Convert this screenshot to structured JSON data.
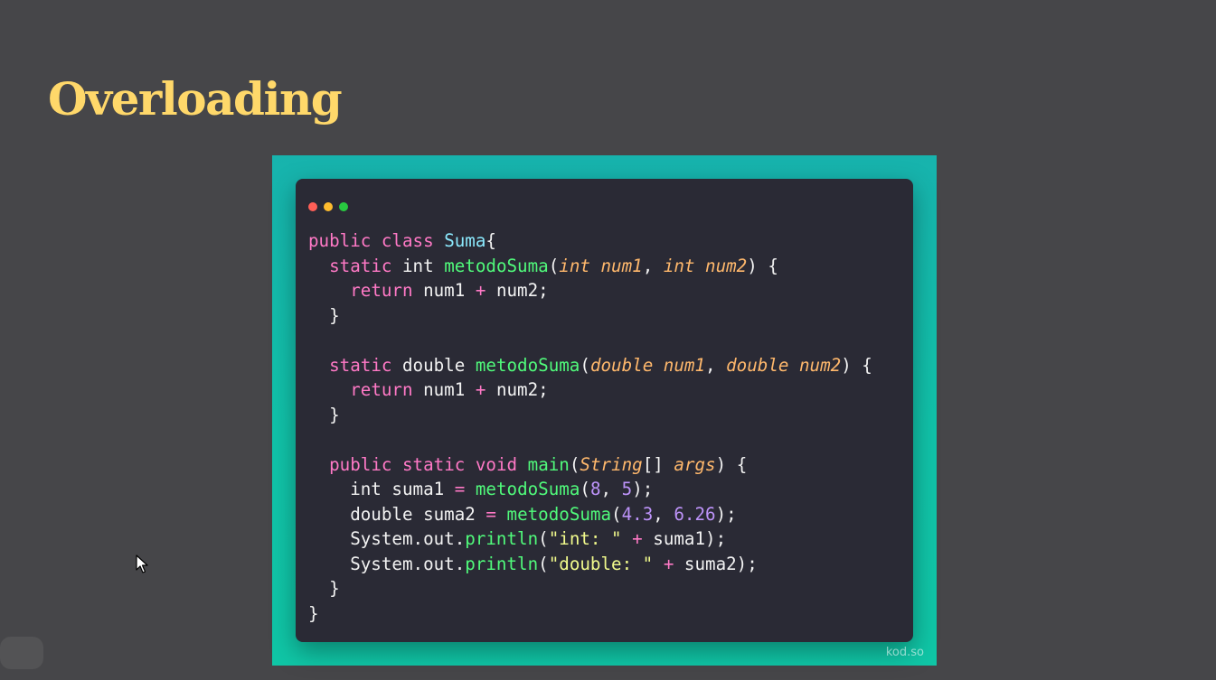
{
  "slide": {
    "title": "Overloading",
    "watermark": "kod.so"
  },
  "window_controls": [
    "close-dot",
    "minimize-dot",
    "maximize-dot"
  ],
  "colors": {
    "title": "#ffd86a",
    "background": "#464649",
    "frame_teal": "#11c3a9",
    "editor_bg": "#2a2a35",
    "keyword": "#ff79c6",
    "class_name": "#8be9fd",
    "function": "#50fa7b",
    "parameter": "#ffb86c",
    "number": "#bd93f9",
    "string": "#f1fa8c"
  },
  "code_lines": [
    [
      [
        "keyword",
        "public"
      ],
      [
        "plain",
        " "
      ],
      [
        "keyword",
        "class"
      ],
      [
        "plain",
        " "
      ],
      [
        "class",
        "Suma"
      ],
      [
        "plain",
        "{"
      ]
    ],
    [
      [
        "plain",
        "  "
      ],
      [
        "keyword",
        "static"
      ],
      [
        "plain",
        " int "
      ],
      [
        "func",
        "metodoSuma"
      ],
      [
        "plain",
        "("
      ],
      [
        "param",
        "int num1"
      ],
      [
        "plain",
        ", "
      ],
      [
        "param",
        "int num2"
      ],
      [
        "plain",
        ") {"
      ]
    ],
    [
      [
        "plain",
        "    "
      ],
      [
        "keyword",
        "return"
      ],
      [
        "plain",
        " num1 "
      ],
      [
        "keyword",
        "+"
      ],
      [
        "plain",
        " num2;"
      ]
    ],
    [
      [
        "plain",
        "  }"
      ]
    ],
    [
      [
        "plain",
        ""
      ]
    ],
    [
      [
        "plain",
        "  "
      ],
      [
        "keyword",
        "static"
      ],
      [
        "plain",
        " double "
      ],
      [
        "func",
        "metodoSuma"
      ],
      [
        "plain",
        "("
      ],
      [
        "param",
        "double num1"
      ],
      [
        "plain",
        ", "
      ],
      [
        "param",
        "double num2"
      ],
      [
        "plain",
        ") {"
      ]
    ],
    [
      [
        "plain",
        "    "
      ],
      [
        "keyword",
        "return"
      ],
      [
        "plain",
        " num1 "
      ],
      [
        "keyword",
        "+"
      ],
      [
        "plain",
        " num2;"
      ]
    ],
    [
      [
        "plain",
        "  }"
      ]
    ],
    [
      [
        "plain",
        ""
      ]
    ],
    [
      [
        "plain",
        "  "
      ],
      [
        "keyword",
        "public"
      ],
      [
        "plain",
        " "
      ],
      [
        "keyword",
        "static"
      ],
      [
        "plain",
        " "
      ],
      [
        "keyword",
        "void"
      ],
      [
        "plain",
        " "
      ],
      [
        "func",
        "main"
      ],
      [
        "plain",
        "("
      ],
      [
        "param",
        "String"
      ],
      [
        "plain",
        "[] "
      ],
      [
        "param",
        "args"
      ],
      [
        "plain",
        ") {"
      ]
    ],
    [
      [
        "plain",
        "    int suma1 "
      ],
      [
        "keyword",
        "="
      ],
      [
        "plain",
        " "
      ],
      [
        "func",
        "metodoSuma"
      ],
      [
        "plain",
        "("
      ],
      [
        "number",
        "8"
      ],
      [
        "plain",
        ", "
      ],
      [
        "number",
        "5"
      ],
      [
        "plain",
        ");"
      ]
    ],
    [
      [
        "plain",
        "    double suma2 "
      ],
      [
        "keyword",
        "="
      ],
      [
        "plain",
        " "
      ],
      [
        "func",
        "metodoSuma"
      ],
      [
        "plain",
        "("
      ],
      [
        "number",
        "4.3"
      ],
      [
        "plain",
        ", "
      ],
      [
        "number",
        "6.26"
      ],
      [
        "plain",
        ");"
      ]
    ],
    [
      [
        "plain",
        "    System.out."
      ],
      [
        "func",
        "println"
      ],
      [
        "plain",
        "("
      ],
      [
        "string",
        "\"int: \""
      ],
      [
        "plain",
        " "
      ],
      [
        "keyword",
        "+"
      ],
      [
        "plain",
        " suma1);"
      ]
    ],
    [
      [
        "plain",
        "    System.out."
      ],
      [
        "func",
        "println"
      ],
      [
        "plain",
        "("
      ],
      [
        "string",
        "\"double: \""
      ],
      [
        "plain",
        " "
      ],
      [
        "keyword",
        "+"
      ],
      [
        "plain",
        " suma2);"
      ]
    ],
    [
      [
        "plain",
        "  }"
      ]
    ],
    [
      [
        "plain",
        "}"
      ]
    ]
  ],
  "cursor_icon": "mouse-pointer-icon"
}
